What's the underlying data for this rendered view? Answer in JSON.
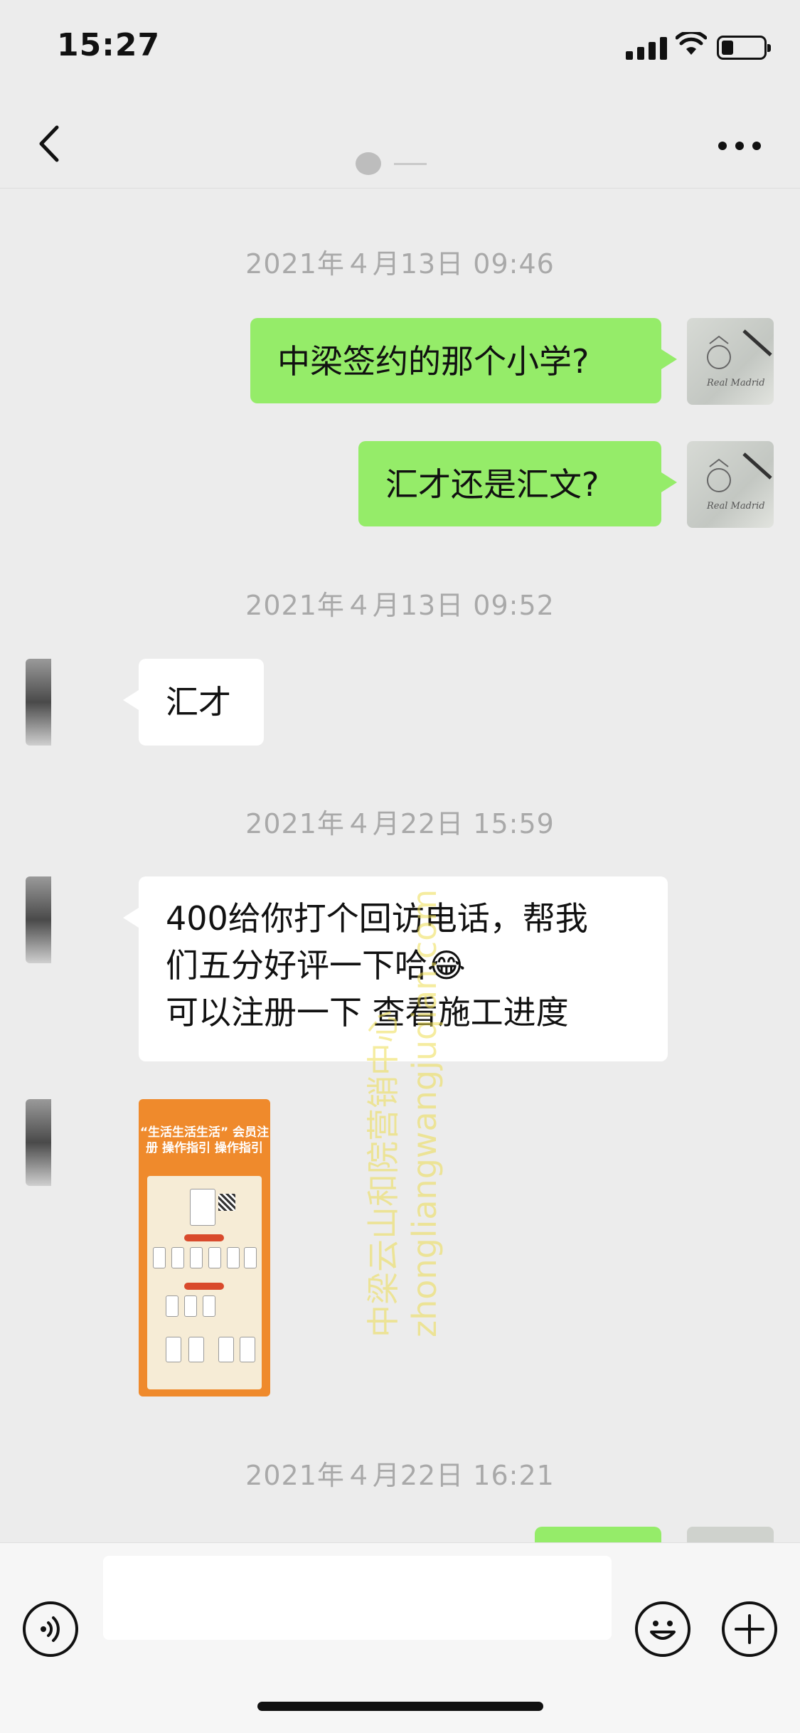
{
  "status_bar": {
    "time": "15:27"
  },
  "nav": {
    "back_icon": "chevron-left-icon",
    "more_icon": "ellipsis-icon"
  },
  "timestamps": [
    "2021年４月13日 09:46",
    "2021年４月13日 09:52",
    "2021年４月22日 15:59",
    "2021年４月22日 16:21"
  ],
  "messages": [
    {
      "from": "me",
      "text": "中梁签约的那个小学?"
    },
    {
      "from": "me",
      "text": "汇才还是汇文?"
    },
    {
      "from": "them",
      "text": "汇才"
    },
    {
      "from": "them",
      "text": "400给你打个回访电话，帮我\n们五分好评一下哈😂\n可以注册一下  查看施工进度"
    },
    {
      "from": "them",
      "type": "image",
      "poster_title": "“生活生活生活” 会员注册\n操作指引    操作指引"
    }
  ],
  "avatar_me_caption": "Real Madrid",
  "watermark": "中梁云山和院营销中心\nzhongliangwangjuqian.com",
  "input_bar": {
    "voice_icon": "voice-icon",
    "emoji_icon": "emoji-icon",
    "plus_icon": "plus-icon"
  },
  "colors": {
    "my_bubble": "#95ec69",
    "their_bubble": "#ffffff",
    "background": "#ececec"
  }
}
